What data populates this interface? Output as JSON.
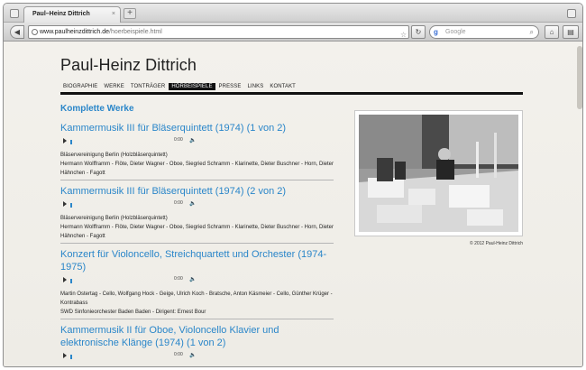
{
  "browser": {
    "tab_title": "Paul–Heinz Dittrich",
    "tab_close": "×",
    "new_tab": "+",
    "url_domain": "www.paulheinzdittrich.de",
    "url_path": "/hoerbeispiele.html",
    "search_placeholder": "Google"
  },
  "site": {
    "title": "Paul-Heinz Dittrich",
    "nav": [
      {
        "label": "BIOGRAPHIE",
        "active": false
      },
      {
        "label": "WERKE",
        "active": false
      },
      {
        "label": "TONTRÄGER",
        "active": false
      },
      {
        "label": "HÖRBEISPIELE",
        "active": true
      },
      {
        "label": "PRESSE",
        "active": false
      },
      {
        "label": "LINKS",
        "active": false
      },
      {
        "label": "KONTAKT",
        "active": false
      }
    ],
    "accent_color": "#2a86c9"
  },
  "main": {
    "section_title": "Komplette Werke",
    "works": [
      {
        "title": "Kammermusik III für Bläserquintett (1974) (1 von 2)",
        "time": "0:00",
        "ensemble": "Bläservereinigung Berlin (Holzbläserquintett)",
        "players": "Hermann Wolfframm - Flöte, Dieter Wagner - Oboe, Siegried Schramm - Klarinette, Dieter Buschner - Horn, Dieter Hähnchen - Fagott"
      },
      {
        "title": "Kammermusik III für Bläserquintett (1974) (2 von 2)",
        "time": "0:00",
        "ensemble": "Bläservereinigung Berlin (Holzbläserquintett)",
        "players": "Hermann Wolfframm - Flöte, Dieter Wagner - Oboe, Siegried Schramm - Klarinette, Dieter Buschner - Horn, Dieter Hähnchen - Fagott"
      },
      {
        "title": "Konzert für Violoncello, Streichquartett und Orchester (1974-1975)",
        "time": "0:00",
        "ensemble": "",
        "players": "Martin Ostertag - Cello, Wolfgang Hock - Geige, Ulrich Koch - Bratsche, Anton Käsmeier - Cello, Günther Krüger - Kontrabass",
        "players2": "SWD Sinfonieorchester Baden Baden - Dirigent: Ernest Bour"
      },
      {
        "title": "Kammermusik II für Oboe, Violoncello Klavier und elektronische Klänge (1974) (1 von 2)",
        "time": "0:00",
        "ensemble": "",
        "players": ""
      }
    ]
  },
  "aside": {
    "photo_credit": "© 2012 Paul-Heinz Dittrich"
  },
  "icons": {
    "play": "play-icon",
    "volume": "volume-icon"
  }
}
